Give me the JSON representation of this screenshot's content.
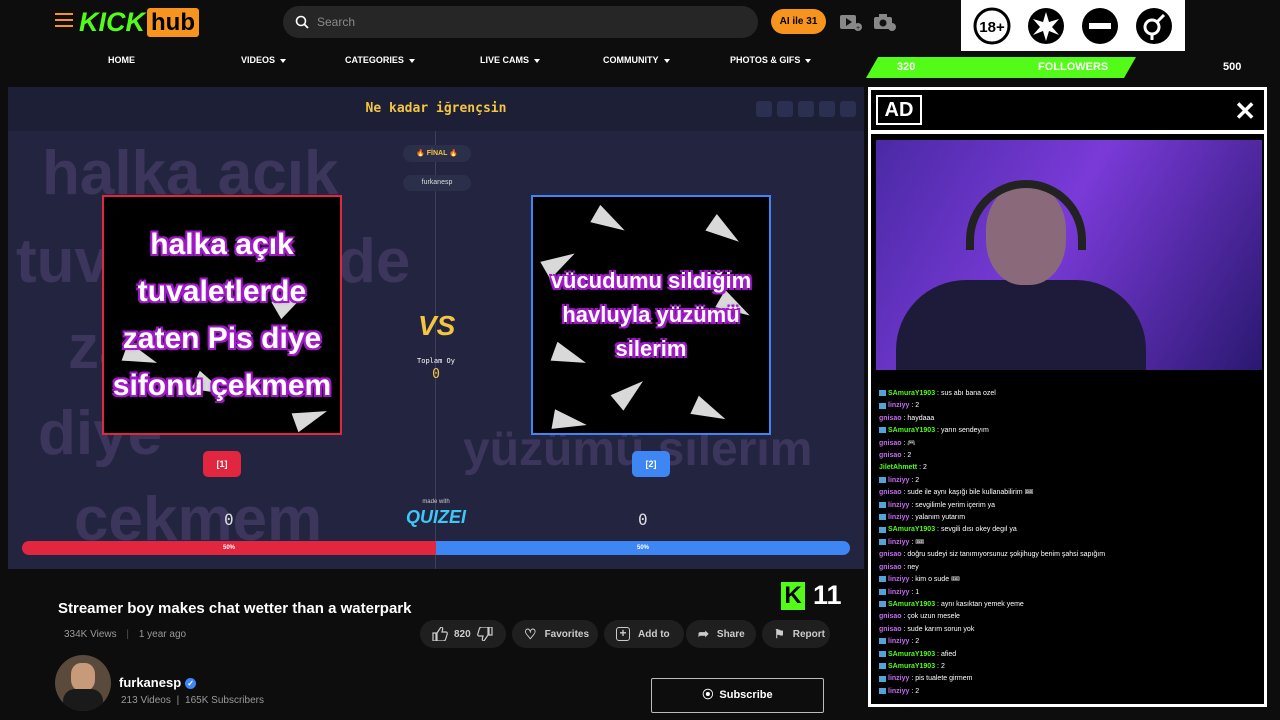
{
  "header": {
    "logo_kick": "KICK",
    "logo_hub": "hub",
    "search_placeholder": "Search",
    "ai_button": "AI ile 31",
    "badges": [
      "18+",
      "",
      "",
      ""
    ]
  },
  "nav": [
    {
      "label": "HOME"
    },
    {
      "label": "VIDEOS"
    },
    {
      "label": "CATEGORIES"
    },
    {
      "label": "LIVE CAMS"
    },
    {
      "label": "COMMUNITY"
    },
    {
      "label": "PHOTOS & GIFS"
    }
  ],
  "followers": {
    "current": "320",
    "label": "FOLLOWERS",
    "goal": "500"
  },
  "quiz": {
    "title": "Ne kadar iğrençsin",
    "final_label": "🔥 FİNAL 🔥",
    "creator": "furkanesp",
    "left_text": "halka açık tuvaletlerde zaten Pis diye sifonu çekmem",
    "right_text": "vücudumu sildiğim havluyla yüzümü silerim",
    "left_num": "[1]",
    "right_num": "[2]",
    "vs": "VS",
    "total_label": "Toplam Oy",
    "total_value": "0",
    "left_score": "0",
    "right_score": "0",
    "made_with": "made with",
    "brand": "QUIZEI",
    "left_pct": "50%",
    "right_pct": "50%",
    "left_share": 50,
    "colors": {
      "left": "#e3263f",
      "right": "#3f86f5"
    }
  },
  "kick_badge": {
    "letter": "K",
    "count": "11"
  },
  "video": {
    "title": "Streamer boy makes chat wetter than a waterpark",
    "views": "334K Views",
    "age": "1 year ago",
    "likes": "820",
    "favorites": "Favorites",
    "add_to": "Add to",
    "share": "Share",
    "report": "Report"
  },
  "channel": {
    "name": "furkanesp",
    "videos": "213 Videos",
    "subscribers": "165K Subscribers",
    "subscribe": "Subscribe"
  },
  "ad": {
    "label": "AD",
    "close": "✕"
  },
  "chat": [
    {
      "user": "SAmuraY1903",
      "msg": "sus abı bana ozel",
      "color": "#53fc18",
      "badge": true
    },
    {
      "user": "linziyy",
      "msg": "2",
      "color": "#c46cf0",
      "badge": true
    },
    {
      "user": "gnisao",
      "msg": "haydaaa",
      "color": "#c46cf0",
      "badge": false
    },
    {
      "user": "SAmuraY1903",
      "msg": "yarın sendeyım",
      "color": "#53fc18",
      "badge": true
    },
    {
      "user": "gnisao",
      "msg": "🎮",
      "color": "#c46cf0",
      "badge": false
    },
    {
      "user": "gnisao",
      "msg": "2",
      "color": "#c46cf0",
      "badge": false
    },
    {
      "user": "JiletAhmett",
      "msg": "2",
      "color": "#53fc18",
      "badge": false
    },
    {
      "user": "linziyy",
      "msg": "2",
      "color": "#c46cf0",
      "badge": true
    },
    {
      "user": "gnisao",
      "msg": "sude ile aynı kaşığı bile kullanabilirim 🎟",
      "color": "#c46cf0",
      "badge": false
    },
    {
      "user": "linziyy",
      "msg": "sevgilimle yerim içerim ya",
      "color": "#c46cf0",
      "badge": true
    },
    {
      "user": "linziyy",
      "msg": "yalanım yutarım",
      "color": "#c46cf0",
      "badge": true
    },
    {
      "user": "SAmuraY1903",
      "msg": "sevgili dısı okey degıl ya",
      "color": "#53fc18",
      "badge": true
    },
    {
      "user": "linziyy",
      "msg": "🎟",
      "color": "#c46cf0",
      "badge": true
    },
    {
      "user": "gnisao",
      "msg": "doğru sudeyi siz tanımıyorsunuz şokjihugy benim şahsi sapığım",
      "color": "#c46cf0",
      "badge": false
    },
    {
      "user": "gnisao",
      "msg": "ney",
      "color": "#c46cf0",
      "badge": false
    },
    {
      "user": "linziyy",
      "msg": "kim o sude 🎟",
      "color": "#c46cf0",
      "badge": true
    },
    {
      "user": "linziyy",
      "msg": "1",
      "color": "#c46cf0",
      "badge": true
    },
    {
      "user": "SAmuraY1903",
      "msg": "aynı kasıktan yemek yeme",
      "color": "#53fc18",
      "badge": true
    },
    {
      "user": "gnisao",
      "msg": "çok uzun mesele",
      "color": "#c46cf0",
      "badge": false
    },
    {
      "user": "gnisao",
      "msg": "sude karım sorun yok",
      "color": "#c46cf0",
      "badge": false
    },
    {
      "user": "linziyy",
      "msg": "2",
      "color": "#c46cf0",
      "badge": true
    },
    {
      "user": "SAmuraY1903",
      "msg": "afied",
      "color": "#53fc18",
      "badge": true
    },
    {
      "user": "SAmuraY1903",
      "msg": "2",
      "color": "#53fc18",
      "badge": true
    },
    {
      "user": "linziyy",
      "msg": "pis tualete girmem",
      "color": "#c46cf0",
      "badge": true
    },
    {
      "user": "linziyy",
      "msg": "2",
      "color": "#c46cf0",
      "badge": true
    }
  ],
  "icons": {
    "menu": "hamburger-icon",
    "search": "search-icon",
    "video": "video-icon",
    "camera": "camera-icon",
    "like": "thumbs-up-icon",
    "dislike": "thumbs-down-icon",
    "favorite": "heart-icon",
    "add": "plus-icon",
    "share": "share-icon",
    "report": "flag-icon",
    "rss": "rss-icon"
  }
}
